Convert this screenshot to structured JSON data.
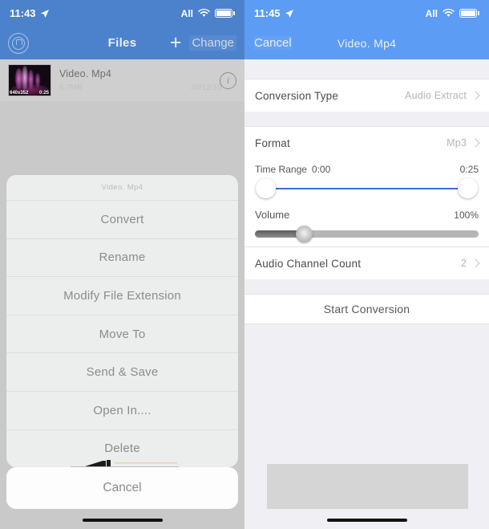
{
  "left_screen": {
    "status_bar": {
      "time": "11:43",
      "location_icon": "location-arrow-icon",
      "carrier": "All",
      "wifi_icon": "wifi-icon",
      "battery_icon": "battery-icon"
    },
    "nav_bar": {
      "home_icon": "home-circle-icon",
      "title": "Files",
      "add_label": "+",
      "change_label": "Change"
    },
    "file_row": {
      "thumb_resolution": "640x352",
      "thumb_duration": "0:25",
      "name": "Video. Mp4",
      "size": "6.7MB",
      "date": "30/12/19",
      "info_icon": "info-icon"
    },
    "action_sheet": {
      "header": "Video. Mp4",
      "items": [
        {
          "label": "Convert"
        },
        {
          "label": "Rename"
        },
        {
          "label": "Modify File Extension"
        },
        {
          "label": "Move To"
        },
        {
          "label": "Send & Save"
        },
        {
          "label": "Open In...."
        },
        {
          "label": "Delete"
        }
      ],
      "cancel_label": "Cancel"
    }
  },
  "right_screen": {
    "status_bar": {
      "time": "11:45",
      "location_icon": "location-arrow-icon",
      "carrier": "All",
      "wifi_icon": "wifi-icon",
      "battery_icon": "battery-icon"
    },
    "nav_bar": {
      "cancel_label": "Cancel",
      "title": "Video. Mp4"
    },
    "settings": {
      "conversion_type": {
        "label": "Conversion Type",
        "value": "Audio Extract"
      },
      "format": {
        "label": "Format",
        "value": "Mp3"
      },
      "time_range": {
        "label": "Time Range",
        "start": "0:00",
        "end": "0:25",
        "start_percent": 0,
        "end_percent": 100
      },
      "volume": {
        "label": "Volume",
        "value": "100%",
        "knob_percent": 22
      },
      "audio_channel_count": {
        "label": "Audio Channel Count",
        "value": "2"
      }
    },
    "start_button_label": "Start Conversion"
  },
  "colors": {
    "left_header_blue": "#4c82cc",
    "right_header_blue": "#5c9cf5",
    "slider_blue": "#3c6fd0",
    "sheet_bg": "#eceded",
    "page_bg": "#f0f0f4"
  }
}
